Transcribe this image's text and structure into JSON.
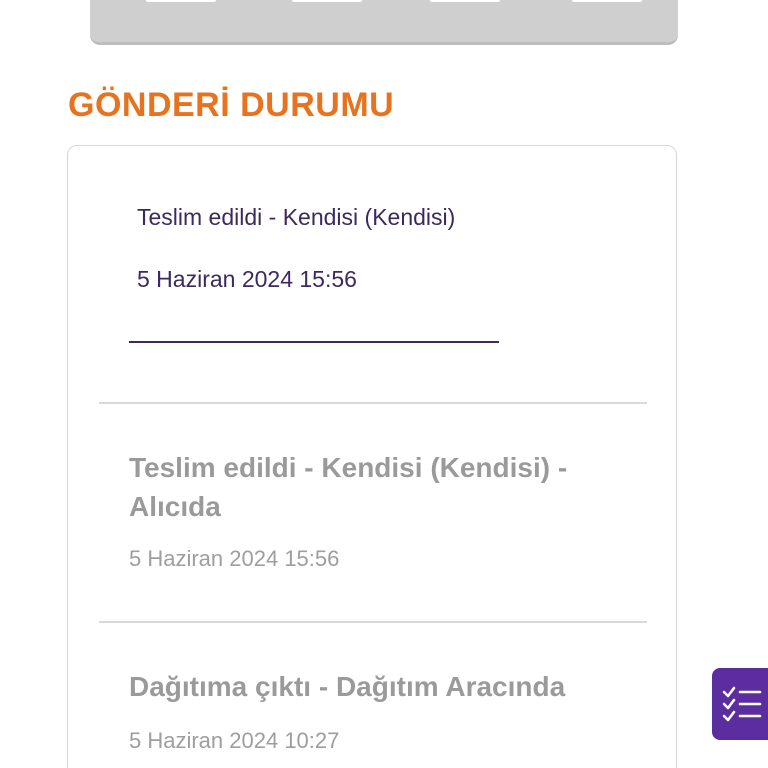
{
  "section_title": "GÖNDERİ DURUMU",
  "current": {
    "status": "Teslim edildi - Kendisi (Kendisi)",
    "date": "5 Haziran 2024 15:56"
  },
  "history": [
    {
      "title": "Teslim edildi - Kendisi (Kendisi) - Alıcıda",
      "date": "5 Haziran 2024 15:56"
    },
    {
      "title": "Dağıtıma çıktı - Dağıtım Aracında",
      "date": "5 Haziran 2024 10:27"
    }
  ],
  "fab": {
    "icon": "checklist-icon"
  },
  "colors": {
    "accent": "#e8731f",
    "primary": "#5b2d9e",
    "text_dark": "#3b2a5f",
    "text_muted": "#9a9a9a"
  }
}
